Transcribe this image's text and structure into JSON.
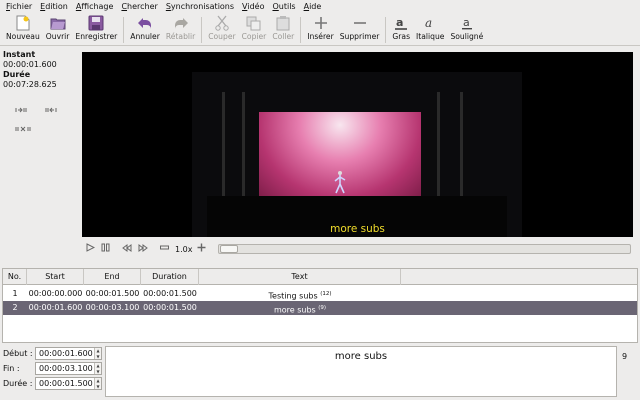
{
  "menu": [
    "Fichier",
    "Edition",
    "Affichage",
    "Chercher",
    "Synchronisations",
    "Vidéo",
    "Outils",
    "Aide"
  ],
  "toolbar": {
    "new": "Nouveau",
    "open": "Ouvrir",
    "save": "Enregistrer",
    "undo": "Annuler",
    "redo": "Rétablir",
    "cut": "Couper",
    "copy": "Copier",
    "paste": "Coller",
    "insert": "Insérer",
    "delete": "Supprimer",
    "bold": "Gras",
    "italic": "Italique",
    "underline": "Souligné"
  },
  "info": {
    "instant_label": "Instant",
    "instant_value": "00:00:01.600",
    "duration_label": "Durée",
    "duration_value": "00:07:28.625"
  },
  "video": {
    "subtitle": "more subs"
  },
  "player": {
    "speed": "1.0x"
  },
  "table": {
    "columns": [
      "No.",
      "Start",
      "End",
      "Duration",
      "Text"
    ],
    "rows": [
      {
        "no": "1",
        "start": "00:00:00.000",
        "end": "00:00:01.500",
        "duration": "00:00:01.500",
        "text": "Testing subs",
        "count": "(12)"
      },
      {
        "no": "2",
        "start": "00:00:01.600",
        "end": "00:00:03.100",
        "duration": "00:00:01.500",
        "text": "more subs",
        "count": "(9)"
      }
    ]
  },
  "editor": {
    "start_label": "Début :",
    "start_value": "00:00:01.600",
    "end_label": "Fin :",
    "end_value": "00:00:03.100",
    "duration_label": "Durée :",
    "duration_value": "00:00:01.500",
    "text": "more subs",
    "char_count": "9"
  }
}
